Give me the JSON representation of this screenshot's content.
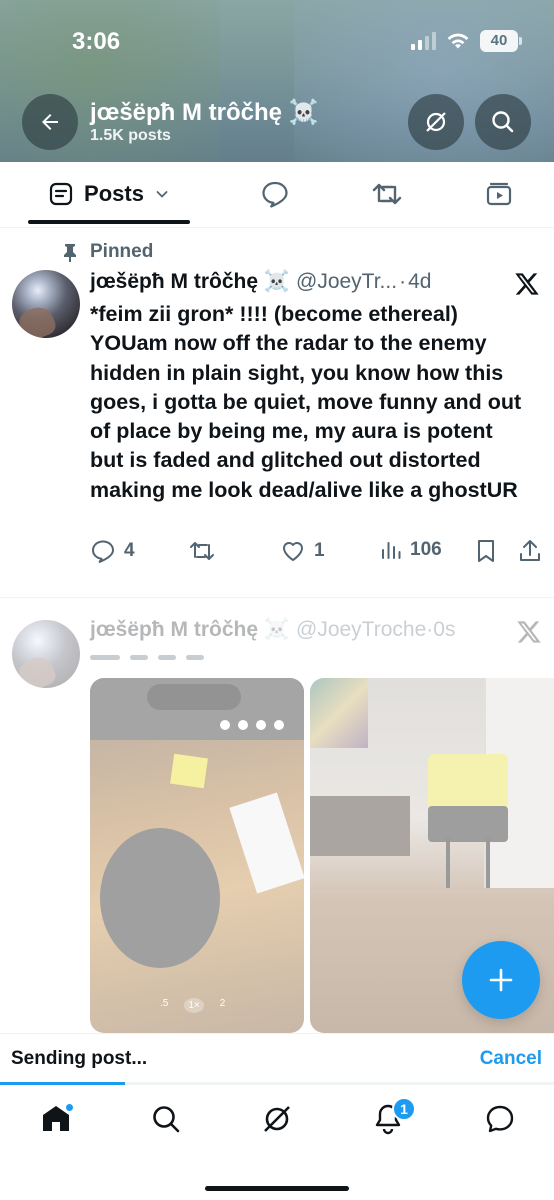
{
  "status_bar": {
    "time": "3:06",
    "battery": "40"
  },
  "header": {
    "profile_name": "jœšëpħ M trôčhę ☠️",
    "post_count": "1.5K posts"
  },
  "tabs": [
    {
      "label": "Posts"
    },
    {
      "label": ""
    },
    {
      "label": ""
    },
    {
      "label": ""
    }
  ],
  "pinned_post": {
    "pinned_label": "Pinned",
    "author_name": "jœšëpħ M trôčhę ☠️",
    "handle": "@JoeyTr...",
    "separator": "·",
    "time": "4d",
    "text": "*feim zii gron* !!!! (become ethereal) YOUam now off the radar to the enemy hidden in plain sight, you know how this goes, i gotta be quiet, move funny and out of place by being me, my aura is potent but is faded and glitched out distorted making me look dead/alive like a ghostUR",
    "replies": "4",
    "reposts": "",
    "likes": "1",
    "views": "106"
  },
  "sending_post": {
    "author_name": "jœšëpħ M trôčhę ☠️",
    "handle": "@JoeyTroche",
    "separator": "·",
    "time": "0s",
    "media_left_zoom": [
      ".5",
      "1×",
      "2"
    ]
  },
  "sending_bar": {
    "label": "Sending post...",
    "cancel": "Cancel",
    "progress": 0.225
  },
  "bottom_nav": {
    "notification_count": "1"
  },
  "colors": {
    "accent": "#1d9bf0",
    "text_primary": "#0f1419",
    "text_secondary": "#536471"
  }
}
